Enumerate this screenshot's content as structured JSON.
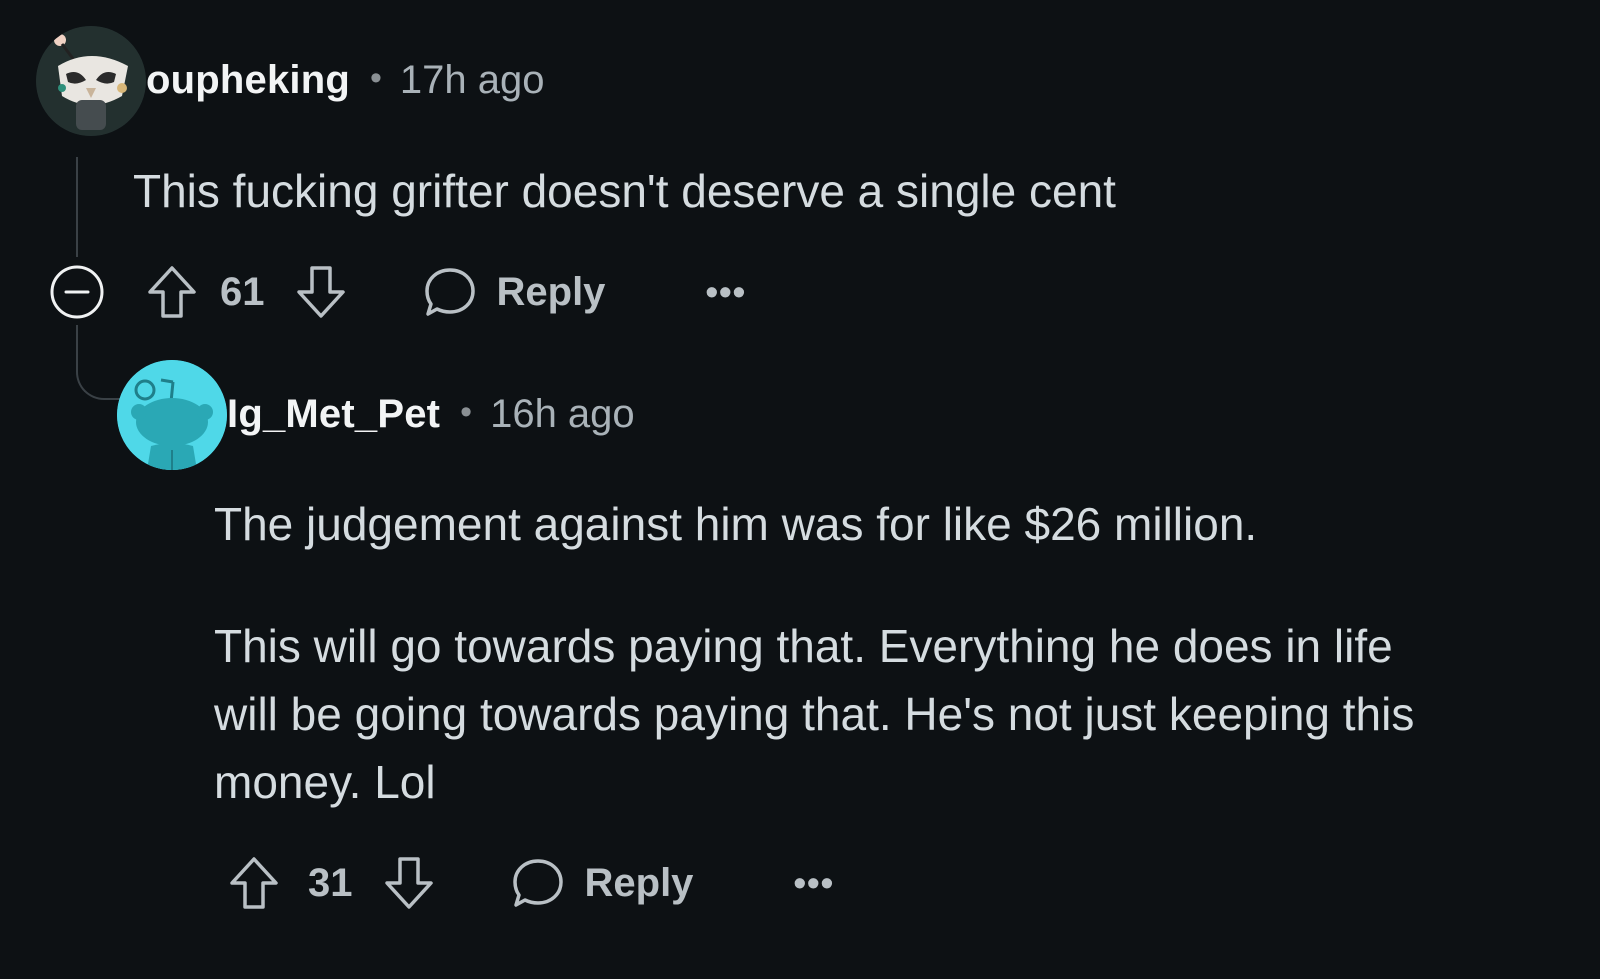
{
  "comments": [
    {
      "username": "oupheking",
      "separator": "•",
      "timestamp": "17h ago",
      "body": [
        "This fucking grifter doesn't deserve a single cent"
      ],
      "score": "61",
      "reply_label": "Reply",
      "more_label": "•••",
      "avatar_icon": "snoo-owl-mask-avatar"
    },
    {
      "username": "Ig_Met_Pet",
      "separator": "•",
      "timestamp": "16h ago",
      "body": [
        "The judgement against him was for like $26 million.",
        "This will go towards paying that. Everything he does in life",
        "will be going towards paying that. He's not just keeping this",
        "money. Lol"
      ],
      "score": "31",
      "reply_label": "Reply",
      "more_label": "•••",
      "avatar_icon": "snoo-default-avatar"
    }
  ],
  "icons": {
    "collapse": "collapse-minus-icon",
    "upvote": "upvote-arrow-icon",
    "downvote": "downvote-arrow-icon",
    "reply": "speech-bubble-icon",
    "more": "more-options-icon"
  },
  "colors": {
    "background": "#0d1114",
    "username": "#f2f4f5",
    "meta": "#a9b2b8",
    "body": "#d5dce0",
    "action": "#b9c0c5",
    "default_avatar": "#4fd8e8"
  }
}
